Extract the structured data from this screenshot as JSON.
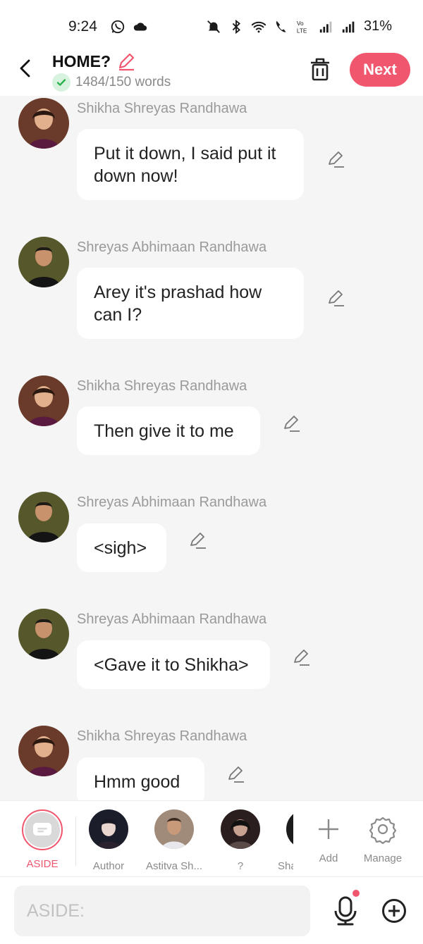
{
  "status_bar": {
    "time": "9:24",
    "battery": "31%",
    "icons": [
      "whatsapp-icon",
      "cloud-icon",
      "mute-icon",
      "bluetooth-icon",
      "wifi-icon",
      "wifi-calling-icon",
      "volte-icon",
      "signal-icon",
      "signal-icon"
    ]
  },
  "header": {
    "title": "HOME?",
    "word_count": "1484/150 words",
    "next_label": "Next"
  },
  "messages": [
    {
      "sender": "Shikha Shreyas Randhawa",
      "text": "Put it down, I said put it down now!",
      "avatar": "female-avatar"
    },
    {
      "sender": "Shreyas Abhimaan Randhawa",
      "text": "Arey it's prashad how can I?",
      "avatar": "male-avatar"
    },
    {
      "sender": "Shikha Shreyas Randhawa",
      "text": "Then give it to me",
      "avatar": "female-avatar"
    },
    {
      "sender": "Shreyas Abhimaan Randhawa",
      "text": "<sigh>",
      "avatar": "male-avatar"
    },
    {
      "sender": "Shreyas Abhimaan Randhawa",
      "text": "<Gave it to Shikha>",
      "avatar": "male-avatar"
    },
    {
      "sender": "Shikha Shreyas Randhawa",
      "text": "Hmm good",
      "avatar": "female-avatar"
    }
  ],
  "characters": [
    {
      "label": "ASIDE",
      "active": true
    },
    {
      "label": "Author"
    },
    {
      "label": "Astitva Sh..."
    },
    {
      "label": "?"
    },
    {
      "label": "Sha"
    }
  ],
  "char_actions": {
    "add_label": "Add",
    "manage_label": "Manage"
  },
  "input": {
    "placeholder": "ASIDE:"
  },
  "colors": {
    "accent": "#f0566e",
    "background": "#f5f5f5",
    "bubble": "#ffffff",
    "check_green": "#2bb24c"
  }
}
